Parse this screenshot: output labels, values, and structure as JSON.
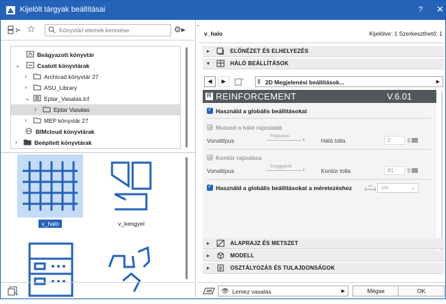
{
  "window": {
    "title": "Kijelölt tárgyak beállításai",
    "help": "?",
    "close": "✕"
  },
  "left": {
    "search_placeholder": "Könyvtári elemek keresése",
    "tree": [
      {
        "label": "Beágyazott könyvtár",
        "bold": true
      },
      {
        "label": "Csatolt könyvtárak",
        "bold": true
      },
      {
        "label": "Archicad könyvtár 27",
        "bold": false
      },
      {
        "label": "ASU_Library",
        "bold": false
      },
      {
        "label": "Eptar_Vasalas.lcf",
        "bold": false
      },
      {
        "label": "Eptar Vasalas",
        "bold": false
      },
      {
        "label": "MEP könyvtár 27",
        "bold": false
      },
      {
        "label": "BIMcloud könyvtárak",
        "bold": true
      },
      {
        "label": "Beépített könyvtárak",
        "bold": true
      }
    ],
    "thumbnails": [
      {
        "label": "v_halo",
        "selected": true
      },
      {
        "label": "v_kengyel",
        "selected": false
      },
      {
        "label": "",
        "selected": false
      },
      {
        "label": "",
        "selected": false
      }
    ]
  },
  "right": {
    "object_name": "v_halo",
    "selection_info": "Kijelölve: 1 Szerkeszthető: 1",
    "sections": {
      "preview": "ELŐNÉZET ÉS ELHELYEZÉS",
      "mesh": "HÁLÓ BEÁLLÍTÁSOK",
      "floorplan": "ALAPRAJZ ÉS METSZET",
      "model": "MODELL",
      "classification": "OSZTÁLYOZÁS ÉS TULAJDONSÁGOK"
    },
    "page_selector": "2D Megjelenési beállítások...",
    "banner": {
      "title": "REINFORCEMENT",
      "version": "V.6.01"
    },
    "use_global": "Használd a globális beállításokat",
    "show_mesh": "Mutasd a háló rajzolatát",
    "line_type_label": "Vonaltípus",
    "line_type_1": "Folytonos",
    "mesh_pen_label": "Háló tolla",
    "mesh_pen_value": "2",
    "outline_draw": "Kontúr rajzolása",
    "line_type_2": "Szaggatott",
    "outline_pen_label": "Kontúr tolla",
    "outline_pen_value": "81",
    "use_global_dim": "Használd a globális beállításokat a méretezéshez",
    "unit_value": "cm"
  },
  "footer": {
    "layer": "Lemez vasalás",
    "cancel": "Mégse",
    "ok": "OK"
  },
  "colors": {
    "accent": "#2663b8",
    "banner": "#52575e",
    "selection": "#c5dcf6"
  }
}
